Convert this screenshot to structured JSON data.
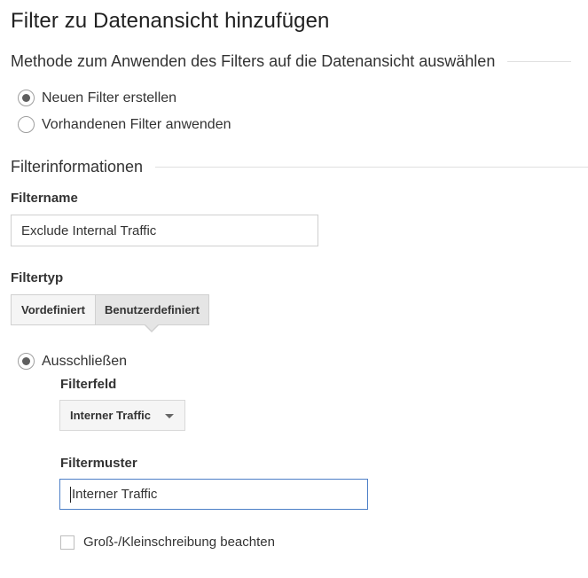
{
  "page": {
    "title": "Filter zu Datenansicht hinzufügen"
  },
  "method_section": {
    "heading": "Methode zum Anwenden des Filters auf die Datenansicht auswählen",
    "options": [
      {
        "label": "Neuen Filter erstellen",
        "selected": true
      },
      {
        "label": "Vorhandenen Filter anwenden",
        "selected": false
      }
    ]
  },
  "info_section": {
    "heading": "Filterinformationen",
    "filtername_label": "Filtername",
    "filtername_value": "Exclude Internal Traffic",
    "filtertyp_label": "Filtertyp",
    "filtertyp_options": [
      {
        "label": "Vordefiniert",
        "selected": false
      },
      {
        "label": "Benutzerdefiniert",
        "selected": true
      }
    ],
    "action": {
      "label": "Ausschließen",
      "selected": true
    },
    "filterfeld_label": "Filterfeld",
    "filterfeld_value": "Interner Traffic",
    "filtermuster_label": "Filtermuster",
    "filtermuster_value": "Interner Traffic",
    "case_sensitive_label": "Groß-/Kleinschreibung beachten",
    "case_sensitive_checked": false
  }
}
